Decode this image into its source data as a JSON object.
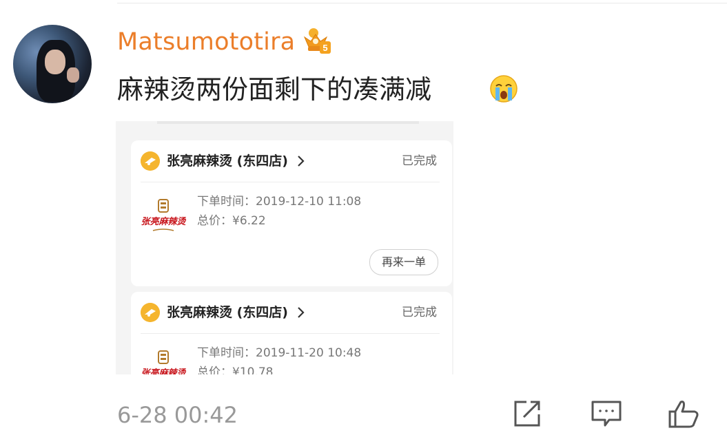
{
  "post": {
    "username": "Matsumototira",
    "vip_level": "5",
    "text": "麻辣烫两份面剩下的凑满减",
    "timestamp": "6-28 00:42"
  },
  "orders": [
    {
      "shop_name": "张亮麻辣烫 (东四店)",
      "status": "已完成",
      "order_time": "下单时间：2019-12-10 11:08",
      "total": "总价：¥6.22",
      "reorder_label": "再来一单"
    },
    {
      "shop_name": "张亮麻辣烫 (东四店)",
      "status": "已完成",
      "order_time": "下单时间：2019-11-20 10:48",
      "total": "总价：¥10.78"
    }
  ],
  "brand_logo_text": "张亮麻辣烫",
  "colors": {
    "username": "#eb7e2a",
    "shop_icon": "#f5b52e",
    "timestamp": "#999999"
  },
  "icons": {
    "vip": "crown-badge-icon",
    "emoji": "crying-face-icon",
    "shop": "shop-icon",
    "share": "share-icon",
    "comment": "comment-icon",
    "like": "thumbs-up-icon"
  }
}
